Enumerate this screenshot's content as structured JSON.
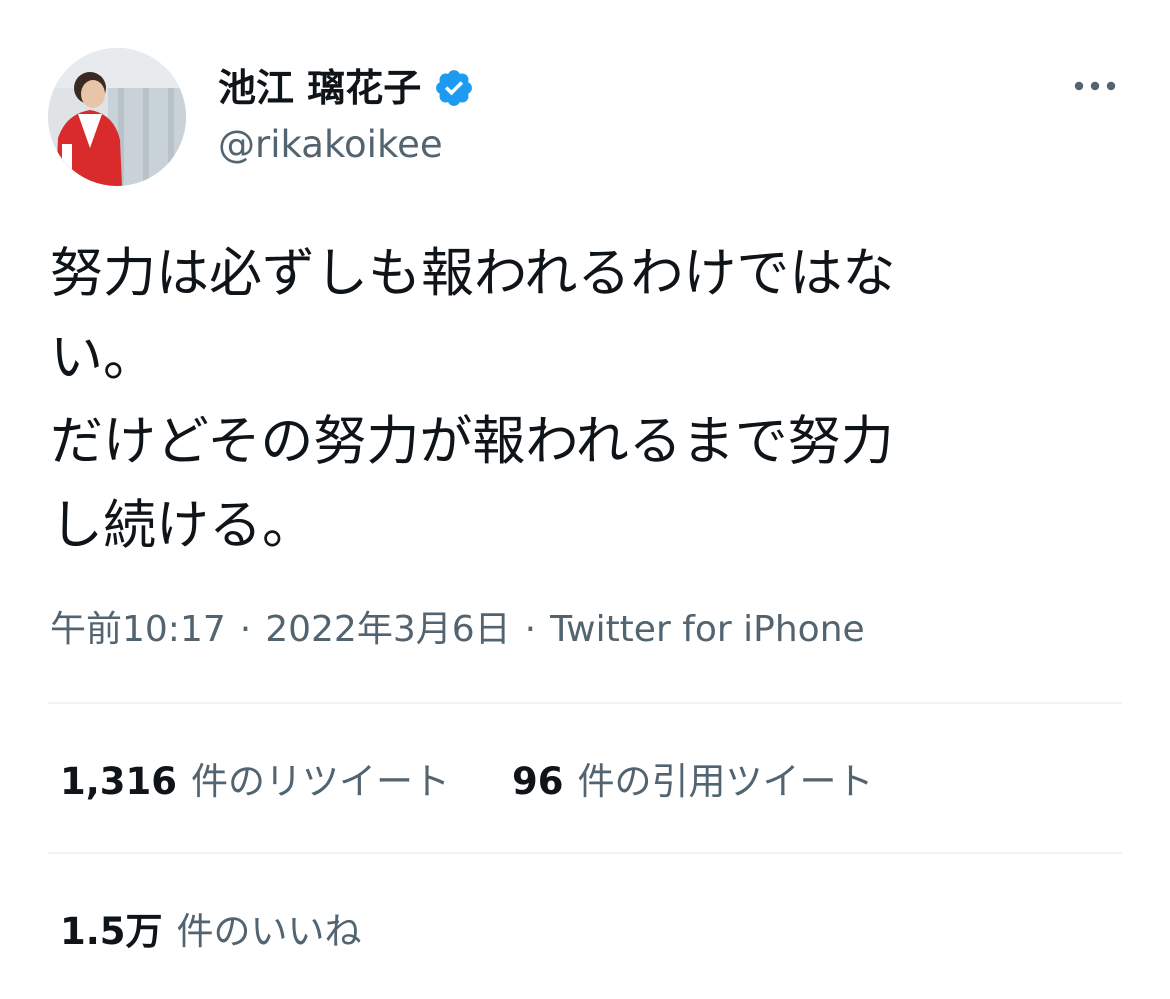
{
  "author": {
    "display_name": "池江 璃花子",
    "handle": "@rikakoikee",
    "verified": true,
    "avatar_icon": "profile-photo"
  },
  "tweet": {
    "lines": [
      "努力は必ずしも報われるわけではな",
      "い。",
      "だけどその努力が報われるまで努力",
      "し続ける。"
    ],
    "time": "午前10:17",
    "date": "2022年3月6日",
    "source": "Twitter for iPhone",
    "separator": "·"
  },
  "stats": {
    "retweets": {
      "count": "1,316",
      "label": "件のリツイート"
    },
    "quotes": {
      "count": "96",
      "label": "件の引用ツイート"
    },
    "likes": {
      "count": "1.5万",
      "label": "件のいいね"
    }
  },
  "colors": {
    "text_primary": "#0f1419",
    "text_secondary": "#536471",
    "verified_blue": "#1d9bf0",
    "divider": "#eff3f4"
  },
  "icons": {
    "verified": "verified-badge-icon",
    "more": "more-options-icon"
  }
}
